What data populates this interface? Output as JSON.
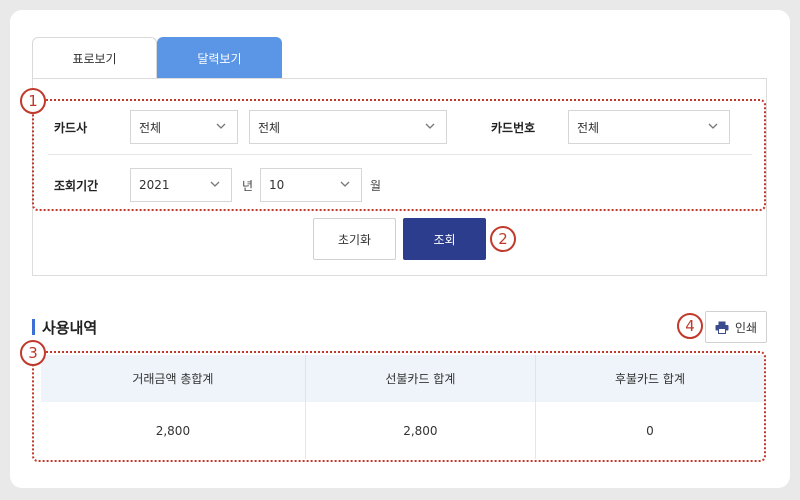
{
  "tabs": [
    {
      "label": "표로보기",
      "active": false
    },
    {
      "label": "달력보기",
      "active": true
    }
  ],
  "filters": {
    "card_company_label": "카드사",
    "card_company_value": "전체",
    "card_type_value": "전체",
    "card_number_label": "카드번호",
    "card_number_value": "전체",
    "period_label": "조회기간",
    "year_value": "2021",
    "year_unit": "년",
    "month_value": "10",
    "month_unit": "월"
  },
  "buttons": {
    "reset_label": "초기화",
    "search_label": "조회",
    "print_label": "인쇄"
  },
  "annotations": [
    "1",
    "2",
    "3",
    "4"
  ],
  "section": {
    "title": "사용내역"
  },
  "summary": {
    "headers": [
      "거래금액 총합계",
      "선불카드 합계",
      "후불카드 합계"
    ],
    "values": [
      "2,800",
      "2,800",
      "0"
    ]
  },
  "colors": {
    "active_tab": "#5b95e6",
    "search_button": "#2c3d8d",
    "annotation": "#c0392b",
    "section_bar": "#3d6fd6",
    "table_header_bg": "#eef4fa"
  }
}
